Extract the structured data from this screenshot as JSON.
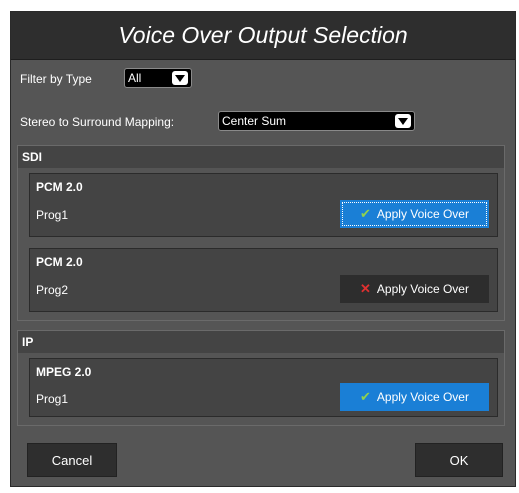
{
  "dialog": {
    "title": "Voice Over Output Selection",
    "filter": {
      "label": "Filter by Type",
      "value": "All"
    },
    "mapping": {
      "label": "Stereo to Surround Mapping:",
      "value": "Center Sum"
    },
    "sections": [
      {
        "name": "SDI",
        "cards": [
          {
            "type": "PCM 2.0",
            "program": "Prog1",
            "button_label": "Apply Voice Over",
            "state": "applied",
            "icon": "check-icon"
          },
          {
            "type": "PCM 2.0",
            "program": "Prog2",
            "button_label": "Apply Voice Over",
            "state": "not-applied",
            "icon": "cross-icon"
          }
        ]
      },
      {
        "name": "IP",
        "cards": [
          {
            "type": "MPEG 2.0",
            "program": "Prog1",
            "button_label": "Apply Voice Over",
            "state": "applied",
            "icon": "check-icon"
          }
        ]
      }
    ],
    "cancel_label": "Cancel",
    "ok_label": "OK"
  },
  "colors": {
    "accent": "#1a7fd6",
    "check": "#8fd14f",
    "cross": "#e03030",
    "panel": "#555555",
    "titlebar": "#2e2e2e"
  }
}
